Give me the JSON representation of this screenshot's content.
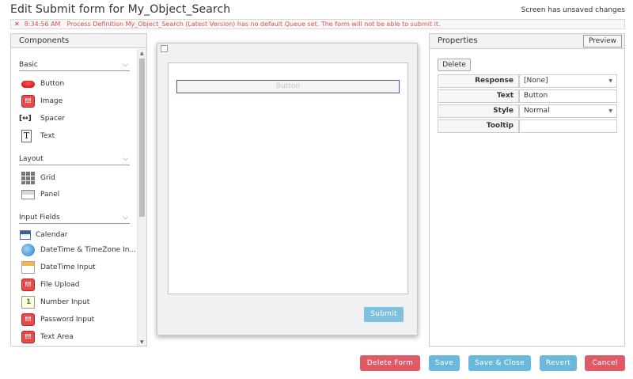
{
  "header": {
    "title": "Edit Submit form for My_Object_Search",
    "unsaved": "Screen has unsaved changes"
  },
  "error": {
    "icon": "close-icon",
    "time": "8:34:56 AM",
    "message": "Process Definition My_Object_Search (Latest Version) has no default Queue set. The form will not be able to submit it."
  },
  "components": {
    "title": "Components",
    "sections": {
      "basic": "Basic",
      "layout": "Layout",
      "input": "Input Fields"
    },
    "basic": [
      "Button",
      "Image",
      "Spacer",
      "Text"
    ],
    "layout": [
      "Grid",
      "Panel"
    ],
    "input": [
      "Calendar",
      "DateTime & TimeZone In...",
      "DateTime Input",
      "File Upload",
      "Number Input",
      "Password Input",
      "Text Area"
    ]
  },
  "canvas": {
    "button_label": "Button",
    "submit_label": "Submit"
  },
  "properties": {
    "title": "Properties",
    "preview": "Preview",
    "delete": "Delete",
    "rows": [
      {
        "label": "Response",
        "value": "[None]"
      },
      {
        "label": "Text",
        "value": "Button"
      },
      {
        "label": "Style",
        "value": "Normal"
      },
      {
        "label": "Tooltip",
        "value": ""
      }
    ]
  },
  "footer": {
    "delete_form": "Delete Form",
    "save": "Save",
    "save_close": "Save & Close",
    "revert": "Revert",
    "cancel": "Cancel"
  },
  "colors": {
    "danger": "#e05a65",
    "primary": "#6ab8da",
    "error_text": "#d9534f"
  }
}
